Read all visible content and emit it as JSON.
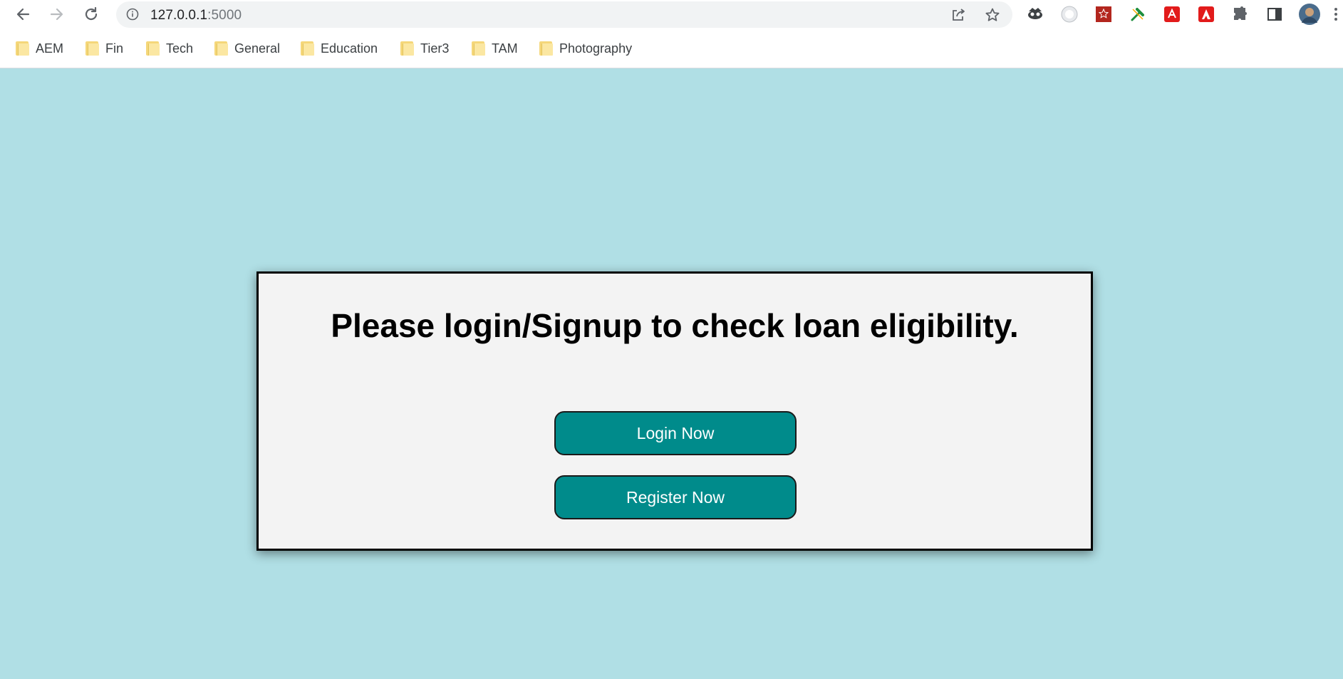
{
  "browser": {
    "url_host": "127.0.0.1",
    "url_port": ":5000",
    "icons": {
      "back": "back-arrow-icon",
      "forward": "forward-arrow-icon",
      "reload": "reload-icon",
      "info": "info-icon",
      "share": "share-icon",
      "bookmark": "star-icon",
      "extensions": "puzzle-icon",
      "side_panel": "side-panel-icon",
      "profile": "avatar",
      "menu": "kebab-menu-icon"
    }
  },
  "bookmarks": [
    {
      "label": "AEM"
    },
    {
      "label": "Fin"
    },
    {
      "label": "Tech"
    },
    {
      "label": "General"
    },
    {
      "label": "Education"
    },
    {
      "label": "Tier3"
    },
    {
      "label": "TAM"
    },
    {
      "label": "Photography"
    }
  ],
  "main": {
    "title": "Please login/Signup to check loan eligibility.",
    "login_label": "Login Now",
    "register_label": "Register Now"
  },
  "colors": {
    "page_background": "#b0dfe5",
    "card_background": "#f3f3f3",
    "button_background": "#008b8b",
    "button_text": "#ffffff"
  }
}
